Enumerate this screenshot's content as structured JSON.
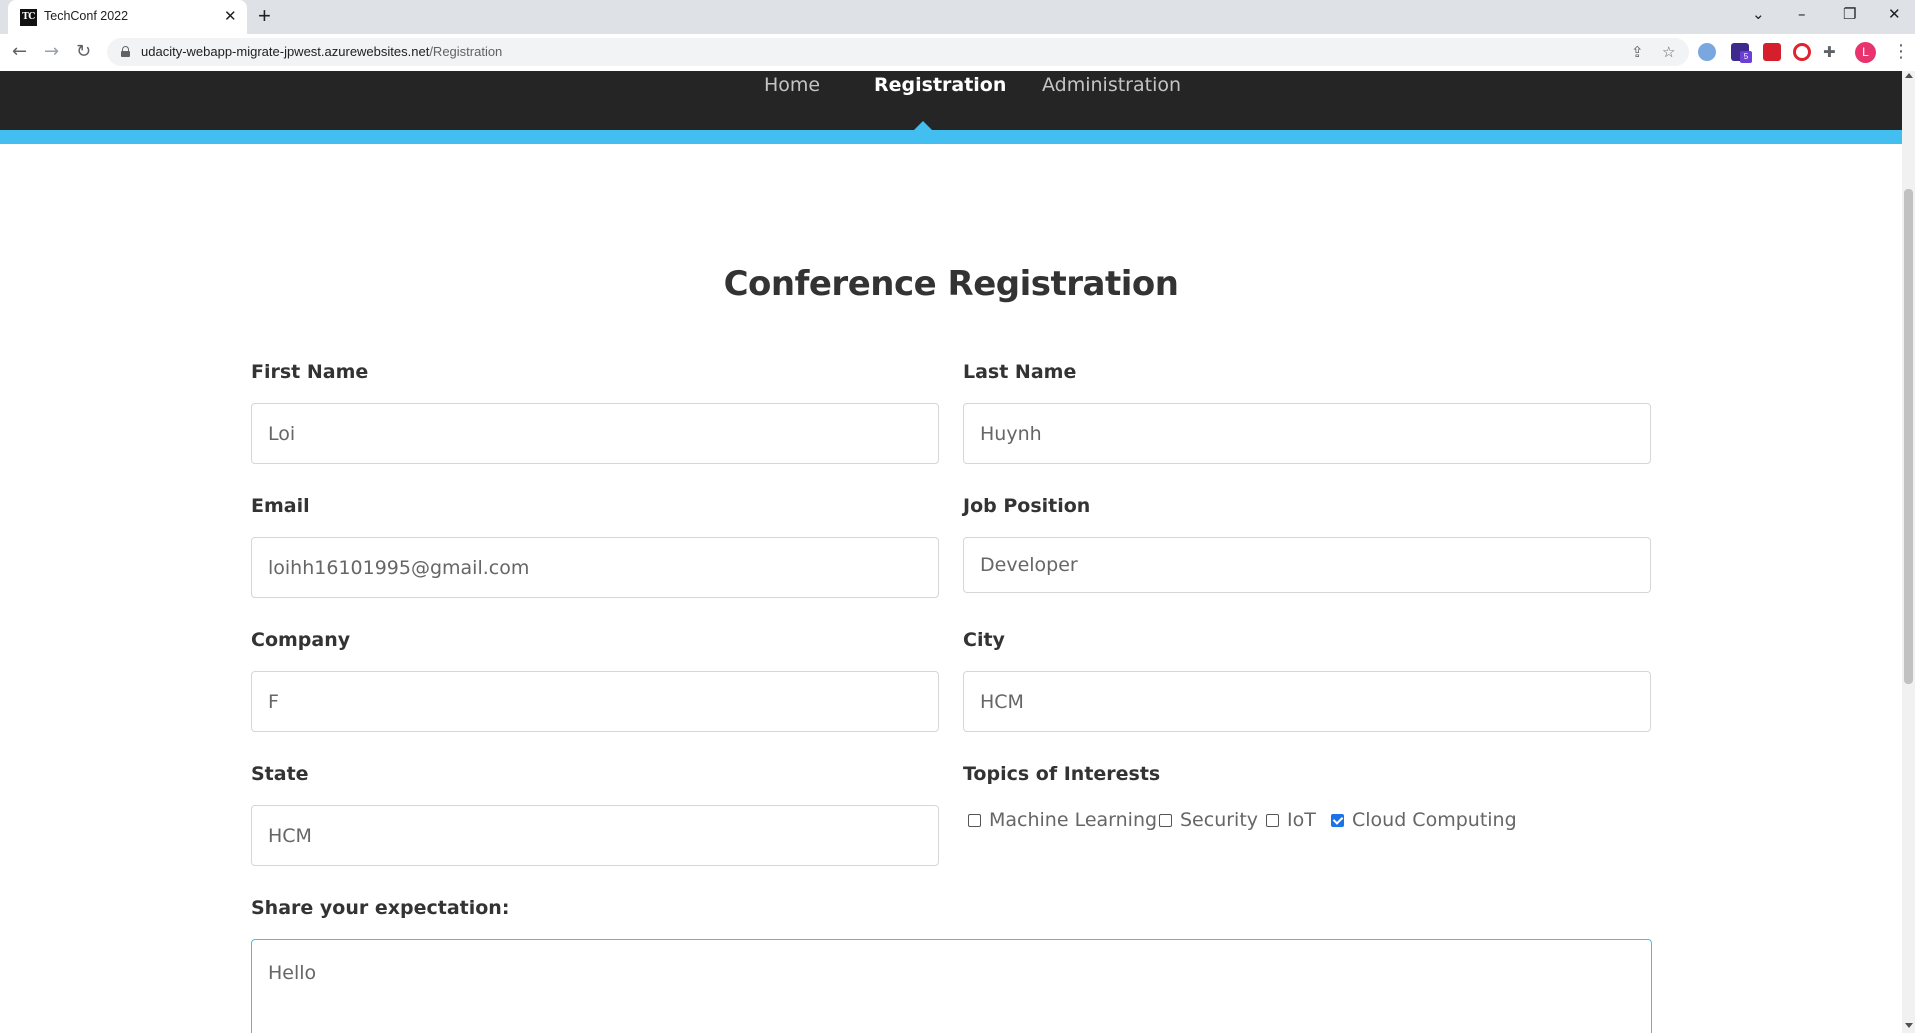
{
  "browser": {
    "tab_title": "TechConf 2022",
    "tab_favicon_text": "TC",
    "url_domain": "udacity-webapp-migrate-jpwest.azurewebsites.net",
    "url_path": "/Registration",
    "profile_initial": "L",
    "extension_badge": "5"
  },
  "nav": {
    "home": "Home",
    "registration": "Registration",
    "administration": "Administration"
  },
  "page": {
    "title": "Conference Registration"
  },
  "form": {
    "first_name": {
      "label": "First Name",
      "value": "Loi"
    },
    "last_name": {
      "label": "Last Name",
      "value": "Huynh"
    },
    "email": {
      "label": "Email",
      "value": "loihh16101995@gmail.com"
    },
    "job_position": {
      "label": "Job Position",
      "value": "Developer"
    },
    "company": {
      "label": "Company",
      "value": "F"
    },
    "city": {
      "label": "City",
      "value": "HCM"
    },
    "state": {
      "label": "State",
      "value": "HCM"
    },
    "topics": {
      "label": "Topics of Interests",
      "options": [
        {
          "label": "Machine Learning",
          "checked": false
        },
        {
          "label": "Security",
          "checked": false
        },
        {
          "label": "IoT",
          "checked": false
        },
        {
          "label": "Cloud Computing",
          "checked": true
        }
      ]
    },
    "expectation": {
      "label": "Share your expectation:",
      "value": "Hello"
    }
  },
  "colors": {
    "nav_background": "#252525",
    "accent": "#43bef0",
    "text_dark": "#333333",
    "input_text": "#666666"
  }
}
